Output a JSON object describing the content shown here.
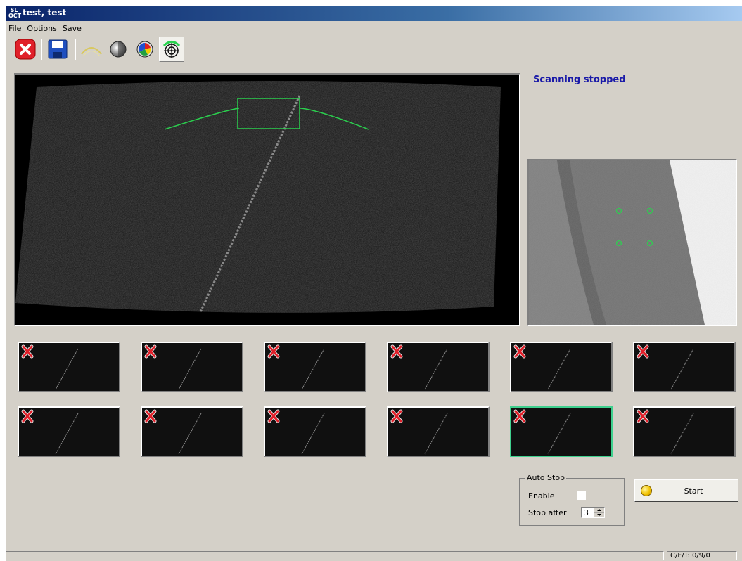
{
  "window": {
    "title": "test, test",
    "app_icon_text": "SL OCT"
  },
  "menu": [
    "File",
    "Options",
    "Save"
  ],
  "toolbar": [
    {
      "name": "close-icon",
      "color": "#e0202a"
    },
    {
      "name": "save-icon",
      "color": "#1f4fbf"
    },
    {
      "name": "arc-icon",
      "color": "#d8c860"
    },
    {
      "name": "contrast-sphere-icon"
    },
    {
      "name": "color-wheel-icon"
    },
    {
      "name": "target-icon",
      "pressed": true
    }
  ],
  "status": {
    "scanning": "Scanning stopped"
  },
  "thumbnails": {
    "count": 12,
    "selected_index": 10,
    "columns": 6
  },
  "autostop": {
    "title": "Auto Stop",
    "enable_label": "Enable",
    "enable_checked": false,
    "stop_after_label": "Stop after",
    "stop_after_value": "3"
  },
  "start_button": {
    "label": "Start",
    "led_color": "#f2c200"
  },
  "statusbar": {
    "right": "C/F/T: 0/9/0"
  },
  "colors": {
    "accent_green": "#2ad24e",
    "status_blue": "#1a1aa8"
  }
}
